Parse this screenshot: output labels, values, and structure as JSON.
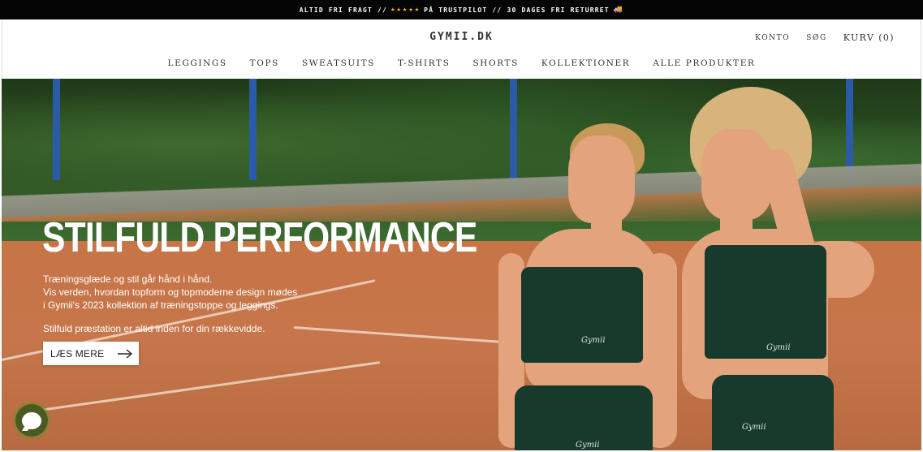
{
  "announcement": {
    "left": "ALTID FRI FRAGT //",
    "stars": "★★★★★",
    "right": "PÅ TRUSTPILOT // 30 DAGES FRI RETURRET",
    "truck_icon": "🚚",
    "stars_color": "#f5b400"
  },
  "header": {
    "logo": "GYMII.DK",
    "konto": "KONTO",
    "search": "SØG",
    "cart": "KURV (0)"
  },
  "nav": {
    "items": [
      "LEGGINGS",
      "TOPS",
      "SWEATSUITS",
      "T-SHIRTS",
      "SHORTS",
      "KOLLEKTIONER",
      "ALLE PRODUKTER"
    ]
  },
  "hero": {
    "title": "STILFULD PERFORMANCE",
    "subtitle_lines": [
      "Træningsglæde og stil går hånd i hånd.",
      "Vis verden, hvordan topform og topmoderne design mødes",
      "i Gymii's 2023 kollektion af træningstoppe og leggings."
    ],
    "tagline": "Stilfuld præstation er altid inden for din rækkevidde.",
    "cta_label": "LÆS MERE",
    "cta_icon": "arrow-right-icon",
    "garment_brand": "Gymii"
  },
  "chat": {
    "icon": "chat-bubble-icon",
    "color": "#4c5a22"
  }
}
